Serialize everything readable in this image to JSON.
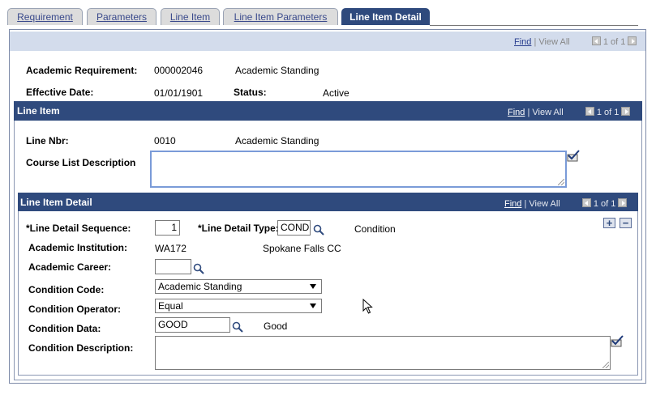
{
  "tabs": [
    {
      "label": "Requirement",
      "active": false
    },
    {
      "label": "Parameters",
      "active": false
    },
    {
      "label": "Line Item",
      "active": false
    },
    {
      "label": "Line Item Parameters",
      "active": false
    },
    {
      "label": "Line Item Detail",
      "active": true
    }
  ],
  "top_nav": {
    "find": "Find",
    "view_all": "View All",
    "count": "1 of 1"
  },
  "requirement": {
    "academic_requirement_label": "Academic Requirement:",
    "academic_requirement_value": "000002046",
    "academic_requirement_desc": "Academic Standing",
    "effective_date_label": "Effective Date:",
    "effective_date_value": "01/01/1901",
    "status_label": "Status:",
    "status_value": "Active"
  },
  "line_item": {
    "title": "Line Item",
    "nav": {
      "find": "Find",
      "view_all": "View All",
      "count": "1 of 1"
    },
    "line_nbr_label": "Line Nbr:",
    "line_nbr_value": "0010",
    "line_nbr_desc": "Academic Standing",
    "course_list_label": "Course List Description",
    "course_list_value": ""
  },
  "line_item_detail": {
    "title": "Line Item Detail",
    "nav": {
      "find": "Find",
      "view_all": "View All",
      "count": "1 of 1"
    },
    "add_symbol": "+",
    "delete_symbol": "−",
    "sequence_label": "*Line Detail Sequence:",
    "sequence_value": "1",
    "type_label": "*Line Detail Type:",
    "type_value": "COND",
    "type_desc": "Condition",
    "institution_label": "Academic Institution:",
    "institution_value": "WA172",
    "institution_desc": "Spokane Falls CC",
    "career_label": "Academic Career:",
    "career_value": "",
    "condition_code_label": "Condition Code:",
    "condition_code_value": "Academic Standing",
    "condition_operator_label": "Condition Operator:",
    "condition_operator_value": "Equal",
    "condition_data_label": "Condition Data:",
    "condition_data_value": "GOOD",
    "condition_data_desc": "Good",
    "condition_desc_label": "Condition Description:",
    "condition_desc_value": ""
  },
  "colors": {
    "header_bar": "#2f4a7d",
    "light_bar": "#d3dcec",
    "link": "#2a3f8f"
  }
}
